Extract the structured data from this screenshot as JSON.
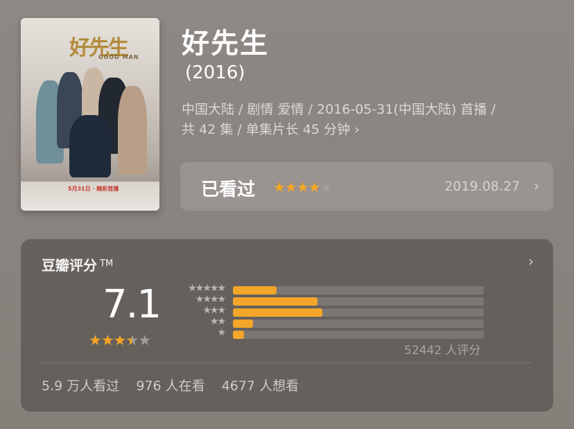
{
  "movie": {
    "title": "好先生",
    "year": "(2016)",
    "info_line1": "中国大陆 / 剧情 爱情 / 2016-05-31(中国大陆) 首播 /",
    "info_line2": "共 42 集 / 单集片长 45 分钟",
    "poster": {
      "title_text": "好先生",
      "subtitle_text": "GOOD MAN",
      "date_text": "5月31日 · 精彩首播"
    }
  },
  "watched": {
    "label": "已看过",
    "stars_on": "★★★★",
    "stars_off": "★",
    "user_rating_stars": 4,
    "date": "2019.08.27"
  },
  "rating": {
    "title": "豆瓣评分",
    "tm": "TM",
    "score": "7.1",
    "stars_on": "★★★",
    "star_half": "★",
    "stars_off": "★",
    "count_text": "52442 人评分",
    "distribution": [
      {
        "stars": "★★★★★",
        "percent": 17.5
      },
      {
        "stars": "★★★★",
        "percent": 33.7
      },
      {
        "stars": "★★★",
        "percent": 35.6
      },
      {
        "stars": "★★",
        "percent": 8.0
      },
      {
        "stars": "★",
        "percent": 4.3
      }
    ],
    "stats": {
      "watched": "5.9 万人看过",
      "watching": "976 人在看",
      "want": "4677 人想看"
    }
  },
  "icons": {
    "chevron": "›"
  },
  "colors": {
    "accent_star": "#f5a623",
    "bar_fill": "#f4a62a"
  }
}
